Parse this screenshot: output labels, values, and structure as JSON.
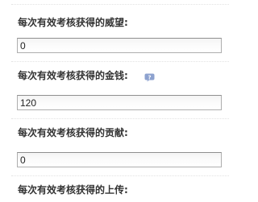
{
  "settings": [
    {
      "label": "每次有效考核获得的威望:",
      "value": "0"
    },
    {
      "label": "每次有效考核获得的金钱:",
      "value": "120",
      "help_icon": "question-bubble-icon"
    },
    {
      "label": "每次有效考核获得的贡献:",
      "value": "0"
    },
    {
      "label": "每次有效考核获得的上传:"
    }
  ],
  "colors": {
    "help_icon": "#8da2cf",
    "input_border": "#aeaeae"
  }
}
